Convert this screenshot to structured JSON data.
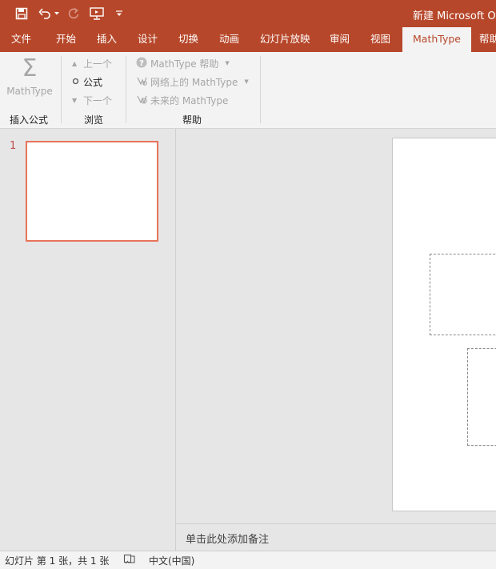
{
  "titlebar": {
    "title": "新建 Microsoft Of",
    "qat": {
      "save_icon": "save-icon",
      "undo_icon": "undo-icon",
      "undo_dropdown_icon": "chevron-down-icon",
      "redo_icon": "redo-icon",
      "present_icon": "present-from-start-icon",
      "customize_icon": "customize-qat-icon"
    }
  },
  "tabs": [
    {
      "label": "文件"
    },
    {
      "label": "开始"
    },
    {
      "label": "插入"
    },
    {
      "label": "设计"
    },
    {
      "label": "切换"
    },
    {
      "label": "动画"
    },
    {
      "label": "幻灯片放映"
    },
    {
      "label": "审阅"
    },
    {
      "label": "视图"
    },
    {
      "label": "MathType",
      "active": true
    },
    {
      "label": "帮助"
    }
  ],
  "ribbon": {
    "insert_group": {
      "button_label": "MathType",
      "icon": "sigma-icon",
      "group_label": "插入公式"
    },
    "browse_group": {
      "prev_label": "上一个",
      "formula_label": "公式",
      "next_label": "下一个",
      "group_label": "浏览"
    },
    "help_group": {
      "help_label": "MathType 帮助",
      "web_label": "网络上的 MathType",
      "future_label": "未来的 MathType",
      "group_label": "帮助"
    }
  },
  "slides_pane": {
    "slide_number": "1"
  },
  "notes": {
    "placeholder": "单击此处添加备注"
  },
  "statusbar": {
    "slide_info": "幻灯片 第 1 张，共 1 张",
    "language": "中文(中国)",
    "accessibility_icon": "accessibility-icon"
  },
  "colors": {
    "accent": "#b7472a",
    "ribbon_bg": "#f3f3f3",
    "workspace_bg": "#e6e6e6",
    "selection": "#e8735a"
  }
}
